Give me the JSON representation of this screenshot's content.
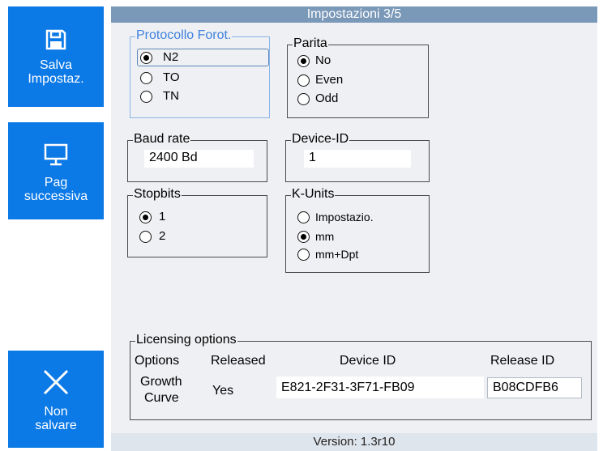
{
  "sidebar": {
    "save": {
      "label": "Salva\nImpostaz.",
      "icon": "floppy-disk-icon"
    },
    "next": {
      "label": "Pag\nsuccessiva",
      "icon": "monitor-icon"
    },
    "cancel": {
      "label": "Non\nsalvare",
      "icon": "close-icon"
    }
  },
  "header": {
    "title": "Impostazioni 3/5"
  },
  "protocol": {
    "legend": "Protocollo Forot.",
    "options": [
      "N2",
      "TO",
      "TN"
    ],
    "selected": "N2"
  },
  "parity": {
    "legend": "Parita",
    "options": [
      "No",
      "Even",
      "Odd"
    ],
    "selected": "No"
  },
  "baud": {
    "legend": "Baud rate",
    "value": "2400 Bd"
  },
  "device": {
    "legend": "Device-ID",
    "value": "1"
  },
  "stopbits": {
    "legend": "Stopbits",
    "options": [
      "1",
      "2"
    ],
    "selected": "1"
  },
  "kunits": {
    "legend": "K-Units",
    "options": [
      "Impostazio.",
      "mm",
      "mm+Dpt"
    ],
    "selected": "mm"
  },
  "licensing": {
    "legend": "Licensing options",
    "headers": {
      "options": "Options",
      "released": "Released",
      "device_id": "Device ID",
      "release_id": "Release ID"
    },
    "row": {
      "option_line1": "Growth",
      "option_line2": "Curve",
      "released": "Yes",
      "device_id": "E821-2F31-3F71-FB09",
      "release_id": "B08CDFB6"
    }
  },
  "footer": {
    "version": "Version: 1.3r10"
  },
  "colors": {
    "accent": "#0b79e6",
    "titlebar": "#7a98b8",
    "panel": "#eef0f3",
    "legend_focus": "#3f82e0"
  }
}
